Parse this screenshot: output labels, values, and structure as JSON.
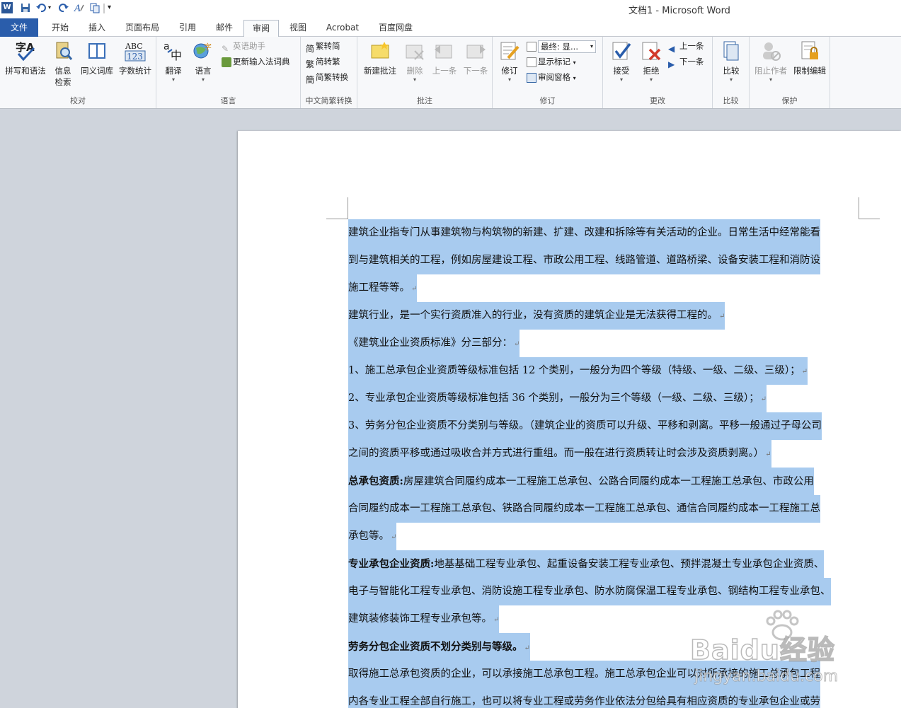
{
  "window": {
    "title": "文档1 - Microsoft Word"
  },
  "tabs": [
    "文件",
    "开始",
    "插入",
    "页面布局",
    "引用",
    "邮件",
    "审阅",
    "视图",
    "Acrobat",
    "百度网盘"
  ],
  "ribbon": {
    "proofing": {
      "label": "校对",
      "spell": "拼写和语法",
      "research": "信息\n检索",
      "thesaurus": "同义词库",
      "wordcount": "字数统计"
    },
    "language": {
      "label": "语言",
      "translate": "翻译",
      "language": "语言",
      "english_assistant": "英语助手",
      "update_ime": "更新输入法词典"
    },
    "chinese": {
      "label": "中文简繁转换",
      "to_simplified": "繁转简",
      "to_traditional": "简转繁",
      "convert": "简繁转换"
    },
    "comments": {
      "label": "批注",
      "new": "新建批注",
      "delete": "删除",
      "prev": "上一条",
      "next": "下一条"
    },
    "tracking": {
      "label": "修订",
      "track": "修订",
      "display": "最终: 显...",
      "show_markup": "显示标记",
      "reviewing_pane": "审阅窗格"
    },
    "changes": {
      "label": "更改",
      "accept": "接受",
      "reject": "拒绝",
      "prev": "上一条",
      "next": "下一条"
    },
    "compare": {
      "label": "比较",
      "compare": "比较"
    },
    "protect": {
      "label": "保护",
      "block_authors": "阻止作者",
      "restrict": "限制编辑"
    }
  },
  "doc": {
    "l1": "建筑企业指专门从事建筑物与构筑物的新建、扩建、改建和拆除等有关活动的企业。日常生活中经常能看",
    "l2": "到与建筑相关的工程，例如房屋建设工程、市政公用工程、线路管道、道路桥梁、设备安装工程和消防设",
    "l3": "施工程等等。",
    "l4": "建筑行业，是一个实行资质准入的行业，没有资质的建筑企业是无法获得工程的。",
    "l5": "《建筑业企业资质标准》分三部分：",
    "l6": "1、施工总承包企业资质等级标准包括 12 个类别，一般分为四个等级（特级、一级、二级、三级）；",
    "l7": "2、专业承包企业资质等级标准包括 36 个类别，一般分为三个等级（一级、二级、三级）；",
    "l8": "3、劳务分包企业资质不分类别与等级。（建筑企业的资质可以升级、平移和剥离。平移一般通过子母公司",
    "l9": "之间的资质平移或通过吸收合并方式进行重组。而一般在进行资质转让时会涉及资质剥离。）",
    "l10b": "总承包资质:",
    "l10": "房屋建筑合同履约成本一工程施工总承包、公路合同履约成本一工程施工总承包、市政公用",
    "l11": "合同履约成本一工程施工总承包、铁路合同履约成本一工程施工总承包、通信合同履约成本一工程施工总",
    "l12": "承包等。",
    "l13b": "专业承包企业资质:",
    "l13": "地基基础工程专业承包、起重设备安装工程专业承包、预拌混凝土专业承包企业资质、",
    "l14": "电子与智能化工程专业承包、消防设施工程专业承包、防水防腐保温工程专业承包、钢结构工程专业承包、",
    "l15": "建筑装修装饰工程专业承包等。",
    "l16b": "劳务分包企业资质不划分类别与等级。",
    "l17": "取得施工总承包资质的企业，可以承接施工总承包工程。施工总承包企业可以对所承接的施工总承包工程",
    "l18": "内各专业工程全部自行施工，也可以将专业工程或劳务作业依法分包给具有相应资质的专业承包企业或劳",
    "pilcrow": "↵"
  },
  "watermark": {
    "brand": "Baidu经验",
    "url": "jingyan.baidu.com"
  }
}
